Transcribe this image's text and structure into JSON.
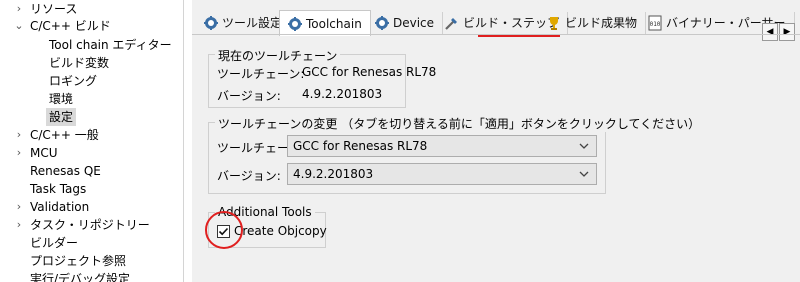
{
  "tree": {
    "items": [
      {
        "label": "リソース",
        "chevron": "right"
      },
      {
        "label": "C/C++ ビルド",
        "chevron": "down"
      },
      {
        "label": "Tool chain エディター",
        "chevron": ""
      },
      {
        "label": "ビルド変数",
        "chevron": ""
      },
      {
        "label": "ロギング",
        "chevron": ""
      },
      {
        "label": "環境",
        "chevron": ""
      },
      {
        "label": "設定",
        "chevron": "",
        "selected": true
      },
      {
        "label": "C/C++ 一般",
        "chevron": "right"
      },
      {
        "label": "MCU",
        "chevron": "right"
      },
      {
        "label": "Renesas QE",
        "chevron": ""
      },
      {
        "label": "Task Tags",
        "chevron": ""
      },
      {
        "label": "Validation",
        "chevron": "right"
      },
      {
        "label": "タスク・リポジトリー",
        "chevron": "right"
      },
      {
        "label": "ビルダー",
        "chevron": ""
      },
      {
        "label": "プロジェクト参照",
        "chevron": ""
      },
      {
        "label": "実行/デバッグ設定",
        "chevron": ""
      }
    ]
  },
  "tabs": [
    {
      "label": "ツール設定",
      "icon": "tool-settings-icon"
    },
    {
      "label": "Toolchain",
      "icon": "toolchain-icon",
      "active": true
    },
    {
      "label": "Device",
      "icon": "device-icon"
    },
    {
      "label": "ビルド・ステップ",
      "icon": "build-steps-icon"
    },
    {
      "label": "ビルド成果物",
      "icon": "trophy-icon"
    },
    {
      "label": "バイナリー・パーサー",
      "icon": "binary-parser-icon"
    }
  ],
  "current_toolchain": {
    "title": "現在のツールチェーン",
    "toolchain_label": "ツールチェーン:",
    "toolchain_value": "GCC for Renesas RL78",
    "version_label": "バージョン:",
    "version_value": "4.9.2.201803"
  },
  "change_toolchain": {
    "title": "ツールチェーンの変更 （タブを切り替える前に「適用」ボタンをクリックしてください）",
    "toolchain_label": "ツールチェーン:",
    "toolchain_selected": "GCC for Renesas RL78",
    "version_label": "バージョン:",
    "version_selected": "4.9.2.201803"
  },
  "additional_tools": {
    "title": "Additional Tools",
    "create_objcopy_label": "Create Objcopy",
    "create_objcopy_checked": true
  },
  "colors": {
    "highlight_red": "#e01f1f",
    "tree_selected_bg": "#d9d9d9",
    "panel_bg": "#f0f0f0"
  }
}
